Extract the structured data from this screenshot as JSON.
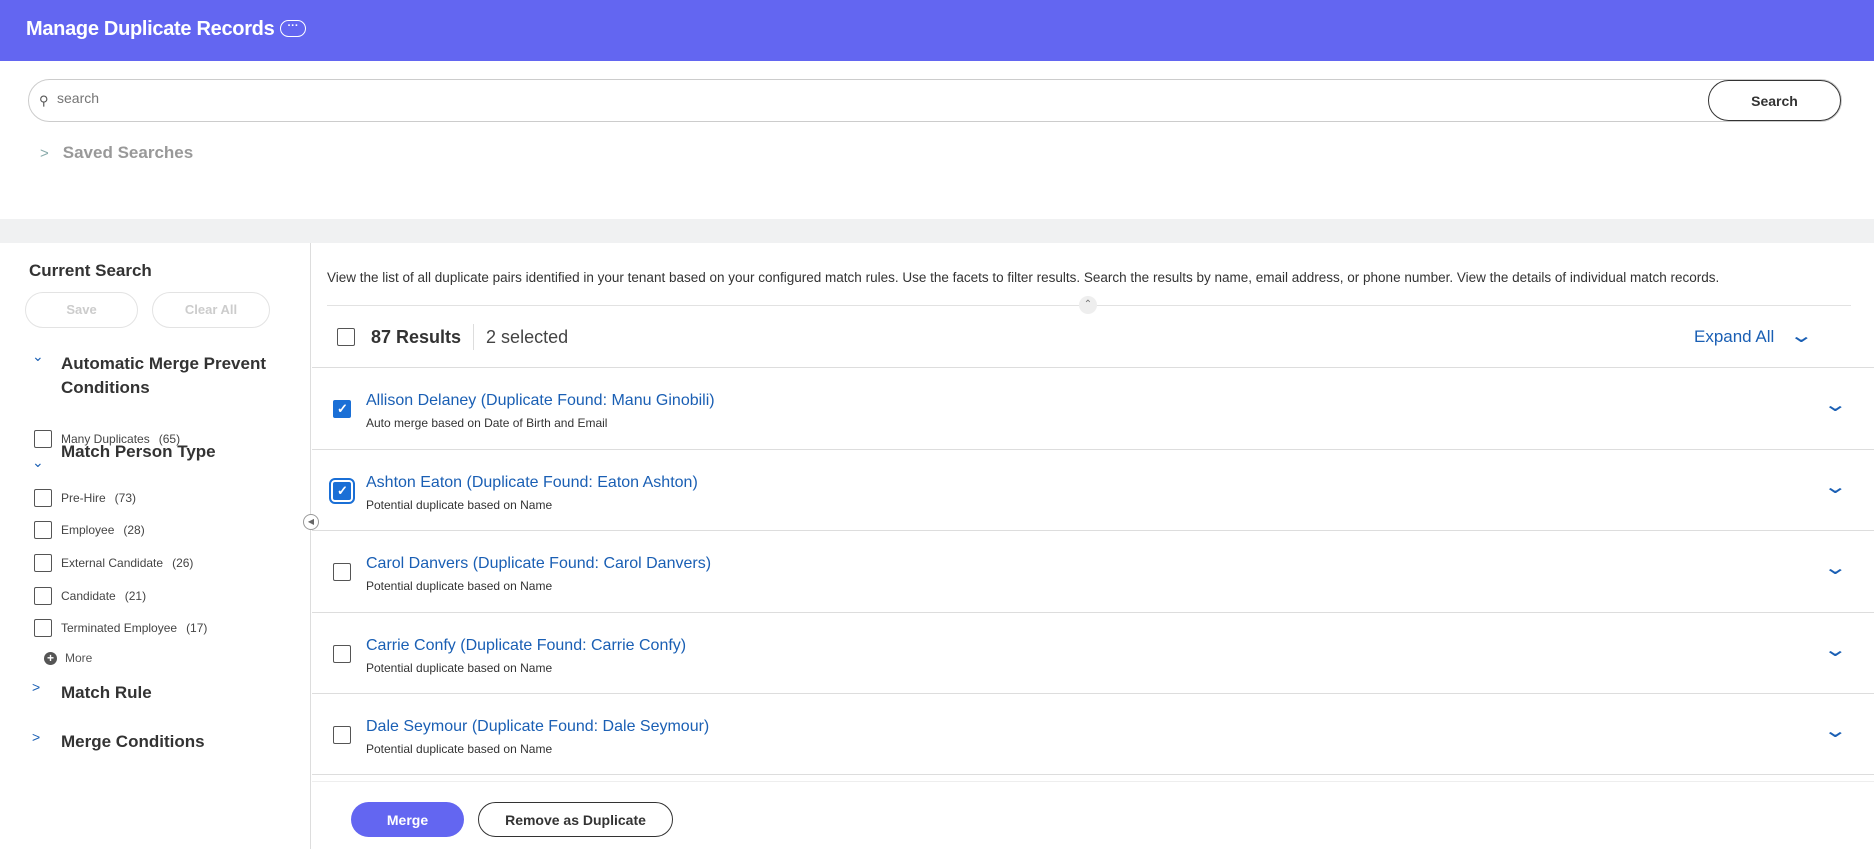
{
  "header": {
    "title": "Manage Duplicate Records",
    "more_icon": "ellipsis-icon",
    "more_label": "···"
  },
  "search": {
    "value": "",
    "placeholder": "search",
    "button": "Search"
  },
  "saved_searches": "Saved Searches",
  "sidebar": {
    "current_search": "Current Search",
    "save": "Save",
    "clear_all": "Clear All",
    "facets": [
      {
        "title": "Automatic Merge Prevent Conditions",
        "expanded": true,
        "items": [
          {
            "label": "Many Duplicates",
            "count": "(65)"
          }
        ]
      },
      {
        "title": "Match Person Type",
        "expanded": true,
        "items": [
          {
            "label": "Pre-Hire",
            "count": "(73)"
          },
          {
            "label": "Employee",
            "count": "(28)"
          },
          {
            "label": "External Candidate",
            "count": "(26)"
          },
          {
            "label": "Candidate",
            "count": "(21)"
          },
          {
            "label": "Terminated Employee",
            "count": "(17)"
          }
        ]
      },
      {
        "title": "Match Rule",
        "expanded": false
      },
      {
        "title": "Merge Conditions",
        "expanded": false
      }
    ],
    "more": "More"
  },
  "main": {
    "description": "View the list of all duplicate pairs identified in your tenant based on your configured match rules. Use the facets to filter results. Search the results by name, email address, or phone number. View the details of individual match records.",
    "results_count": "87 Results",
    "selected": "2 selected",
    "expand_all": "Expand All",
    "rows": [
      {
        "title": "Allison Delaney (Duplicate Found: Manu Ginobili)",
        "subtitle": "Auto merge based on Date of Birth and Email",
        "checked": true
      },
      {
        "title": "Ashton Eaton (Duplicate Found: Eaton Ashton)",
        "subtitle": "Potential duplicate based on Name",
        "checked": true
      },
      {
        "title": "Carol Danvers (Duplicate Found: Carol Danvers)",
        "subtitle": "Potential duplicate based on Name",
        "checked": false
      },
      {
        "title": "Carrie Confy (Duplicate Found: Carrie Confy)",
        "subtitle": "Potential duplicate based on Name",
        "checked": false
      },
      {
        "title": "Dale Seymour (Duplicate Found: Dale Seymour)",
        "subtitle": "Potential duplicate based on Name",
        "checked": false
      }
    ]
  },
  "footer": {
    "merge": "Merge",
    "remove": "Remove as Duplicate"
  },
  "colors": {
    "header": "#6366f1",
    "link": "#1a5fb4",
    "checkbox": "#1a6fd6"
  }
}
